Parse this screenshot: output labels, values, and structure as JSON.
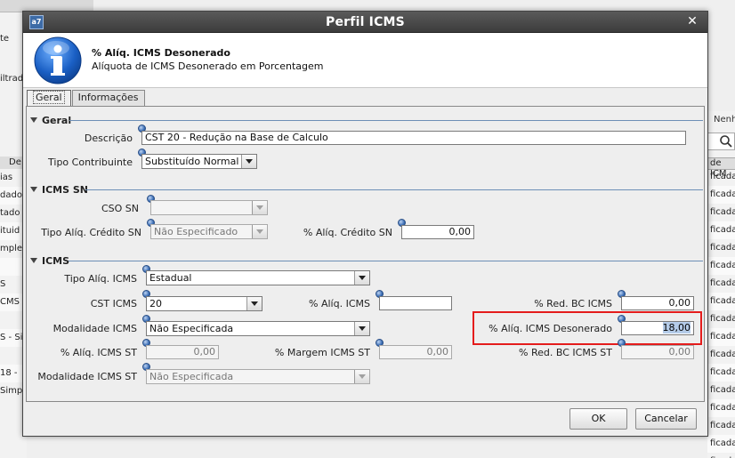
{
  "dialog": {
    "title": "Perfil ICMS",
    "close_glyph": "✕",
    "app_icon_text": "a7"
  },
  "header": {
    "title": "% Alíq. ICMS Desonerado",
    "subtitle": "Alíquota de ICMS Desonerado em Porcentagem",
    "icon": "info-icon"
  },
  "tabs": [
    {
      "label": "Geral",
      "active": true
    },
    {
      "label": "Informações",
      "active": false
    }
  ],
  "sections": {
    "geral": "Geral",
    "icms_sn": "ICMS SN",
    "icms": "ICMS"
  },
  "geral": {
    "descricao_label": "Descrição",
    "descricao_value": "CST 20 - Redução na Base de Calculo",
    "tipo_contribuinte_label": "Tipo Contribuinte",
    "tipo_contribuinte_value": "Substituído Normal"
  },
  "icms_sn": {
    "cso_sn_label": "CSO SN",
    "cso_sn_value": "",
    "tipo_aliq_credito_label": "Tipo Alíq. Crédito SN",
    "tipo_aliq_credito_value": "Não Especificado",
    "aliq_credito_label": "% Alíq. Crédito SN",
    "aliq_credito_value": "0,00"
  },
  "icms": {
    "tipo_aliq_label": "Tipo Alíq. ICMS",
    "tipo_aliq_value": "Estadual",
    "cst_label": "CST ICMS",
    "cst_value": "20",
    "aliq_label": "% Alíq. ICMS",
    "aliq_value": "",
    "red_bc_label": "% Red. BC ICMS",
    "red_bc_value": "0,00",
    "modalidade_label": "Modalidade ICMS",
    "modalidade_value": "Não Especificada",
    "desonerado_label": "% Alíq. ICMS Desonerado",
    "desonerado_value": "18,00",
    "aliq_st_label": "% Alíq. ICMS ST",
    "aliq_st_value": "0,00",
    "margem_st_label": "% Margem ICMS ST",
    "margem_st_value": "0,00",
    "red_bc_st_label": "% Red. BC ICMS ST",
    "red_bc_st_value": "0,00",
    "modalidade_st_label": "Modalidade ICMS ST",
    "modalidade_st_value": "Não Especificada"
  },
  "buttons": {
    "ok": "OK",
    "cancel": "Cancelar"
  },
  "background": {
    "left_texts": [
      "te",
      "iltrad"
    ],
    "left_header": "De",
    "left_rows": [
      "ias",
      "dado",
      "tado",
      "ituid",
      "mples",
      "",
      "S",
      "CMS",
      "",
      "S - Si",
      "",
      "18 -",
      "Simp"
    ],
    "right_label": "Nenh",
    "right_header": "de ICM",
    "right_rows": [
      "ficada",
      "ficada",
      "ficada",
      "ficada",
      "ficada",
      "ficada",
      "ficada",
      "ficada",
      "ficada",
      "ficada",
      "ficada",
      "ficada",
      "ficada",
      "ficada",
      "ficada",
      "ficada",
      "ficada"
    ]
  },
  "colors": {
    "section_line": "#6d8fb6",
    "highlight": "#e41c1c",
    "title_bar": "#3c3c3c",
    "info_icon": "#1a5fc4"
  }
}
